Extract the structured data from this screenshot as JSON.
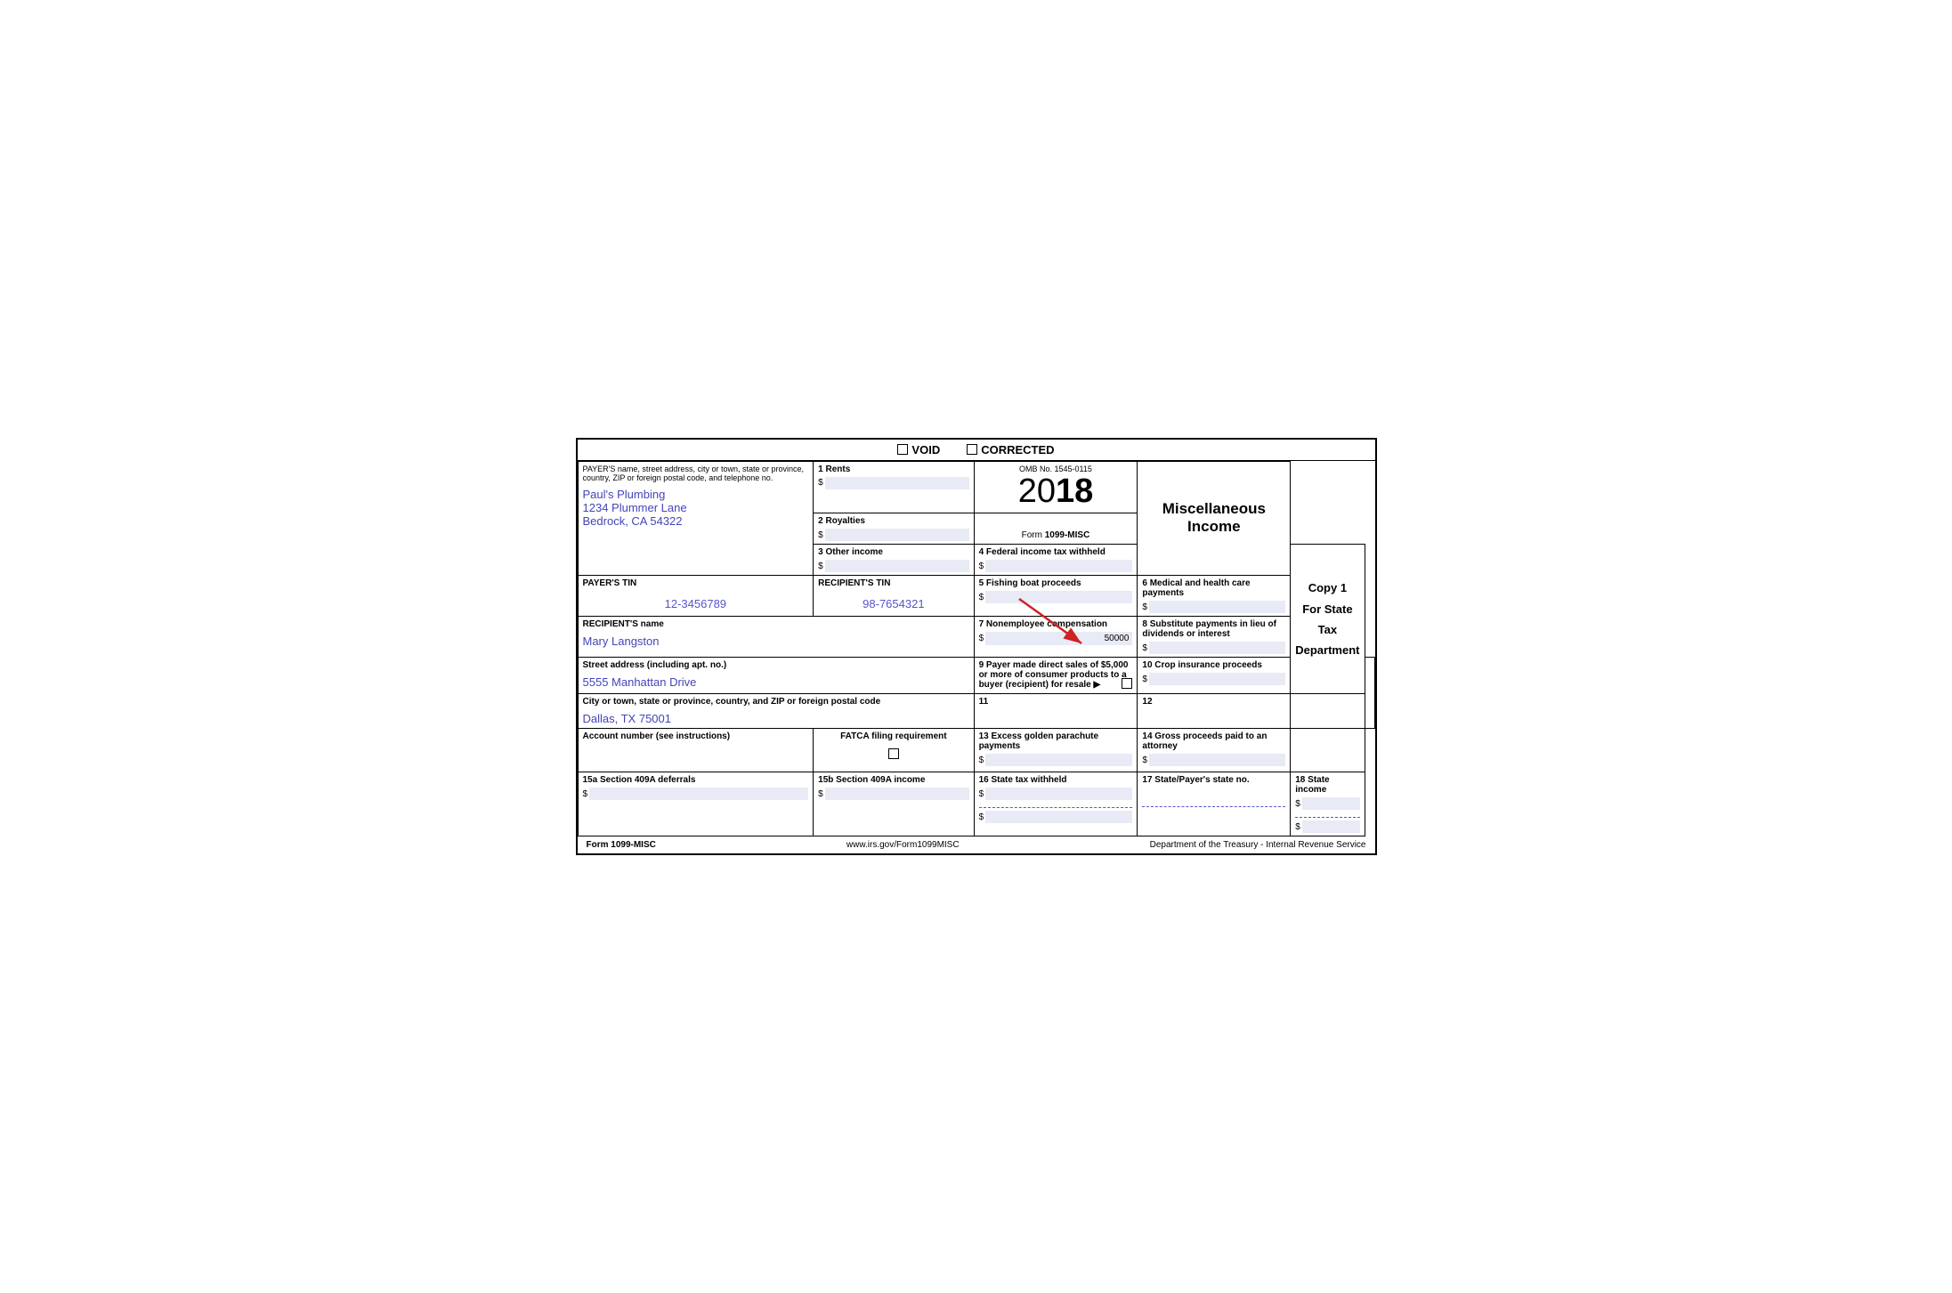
{
  "header": {
    "void_label": "VOID",
    "corrected_label": "CORRECTED"
  },
  "copy": {
    "title": "Copy 1",
    "subtitle": "For State Tax Department"
  },
  "misc_income": {
    "title": "Miscellaneous\nIncome"
  },
  "omb": {
    "number": "OMB No. 1545-0115",
    "year_light": "20",
    "year_bold": "18",
    "form_label": "Form ",
    "form_name": "1099-MISC"
  },
  "payer": {
    "label": "PAYER'S name, street address, city or town, state or province, country, ZIP or foreign postal code, and telephone no.",
    "name": "Paul's Plumbing",
    "address": "1234 Plummer Lane",
    "city": "Bedrock, CA 54322"
  },
  "fields": {
    "f1_label": "1 Rents",
    "f1_value": "",
    "f2_label": "2 Royalties",
    "f2_value": "",
    "f3_label": "3 Other income",
    "f3_value": "",
    "f4_label": "4 Federal income tax withheld",
    "f4_value": "",
    "f5_label": "5 Fishing boat proceeds",
    "f5_value": "",
    "f6_label": "6 Medical and health care payments",
    "f6_value": "",
    "f7_label": "7 Nonemployee compensation",
    "f7_value": "50000",
    "f8_label": "8 Substitute payments in lieu of dividends or interest",
    "f8_value": "",
    "f9_label": "9 Payer made direct sales of $5,000 or more of consumer products to a buyer (recipient) for resale ▶",
    "f10_label": "10 Crop insurance proceeds",
    "f10_value": "",
    "f11_label": "11",
    "f11_value": "",
    "f12_label": "12",
    "f12_value": "",
    "f13_label": "13 Excess golden parachute payments",
    "f13_value": "",
    "f14_label": "14 Gross proceeds paid to an attorney",
    "f14_value": "",
    "f15a_label": "15a Section 409A deferrals",
    "f15a_value": "",
    "f15b_label": "15b Section 409A income",
    "f15b_value": "",
    "f16_label": "16 State tax withheld",
    "f16_value": "",
    "f17_label": "17 State/Payer's state no.",
    "f17_value": "",
    "f18_label": "18 State income",
    "f18_value": ""
  },
  "payer_tin": {
    "label": "PAYER'S TIN",
    "value": "12-3456789"
  },
  "recipient_tin": {
    "label": "RECIPIENT'S TIN",
    "value": "98-7654321"
  },
  "recipient": {
    "name_label": "RECIPIENT'S name",
    "name_value": "Mary Langston",
    "street_label": "Street address (including apt. no.)",
    "street_value": "5555 Manhattan Drive",
    "city_label": "City or town, state or province, country, and ZIP or foreign postal code",
    "city_value": "Dallas, TX 75001"
  },
  "account": {
    "label": "Account number (see instructions)",
    "value": ""
  },
  "fatca": {
    "label": "FATCA filing requirement"
  },
  "footer": {
    "form_label": "Form 1099-MISC",
    "website": "www.irs.gov/Form1099MISC",
    "dept": "Department of the Treasury - Internal Revenue Service"
  },
  "dollar": "$"
}
